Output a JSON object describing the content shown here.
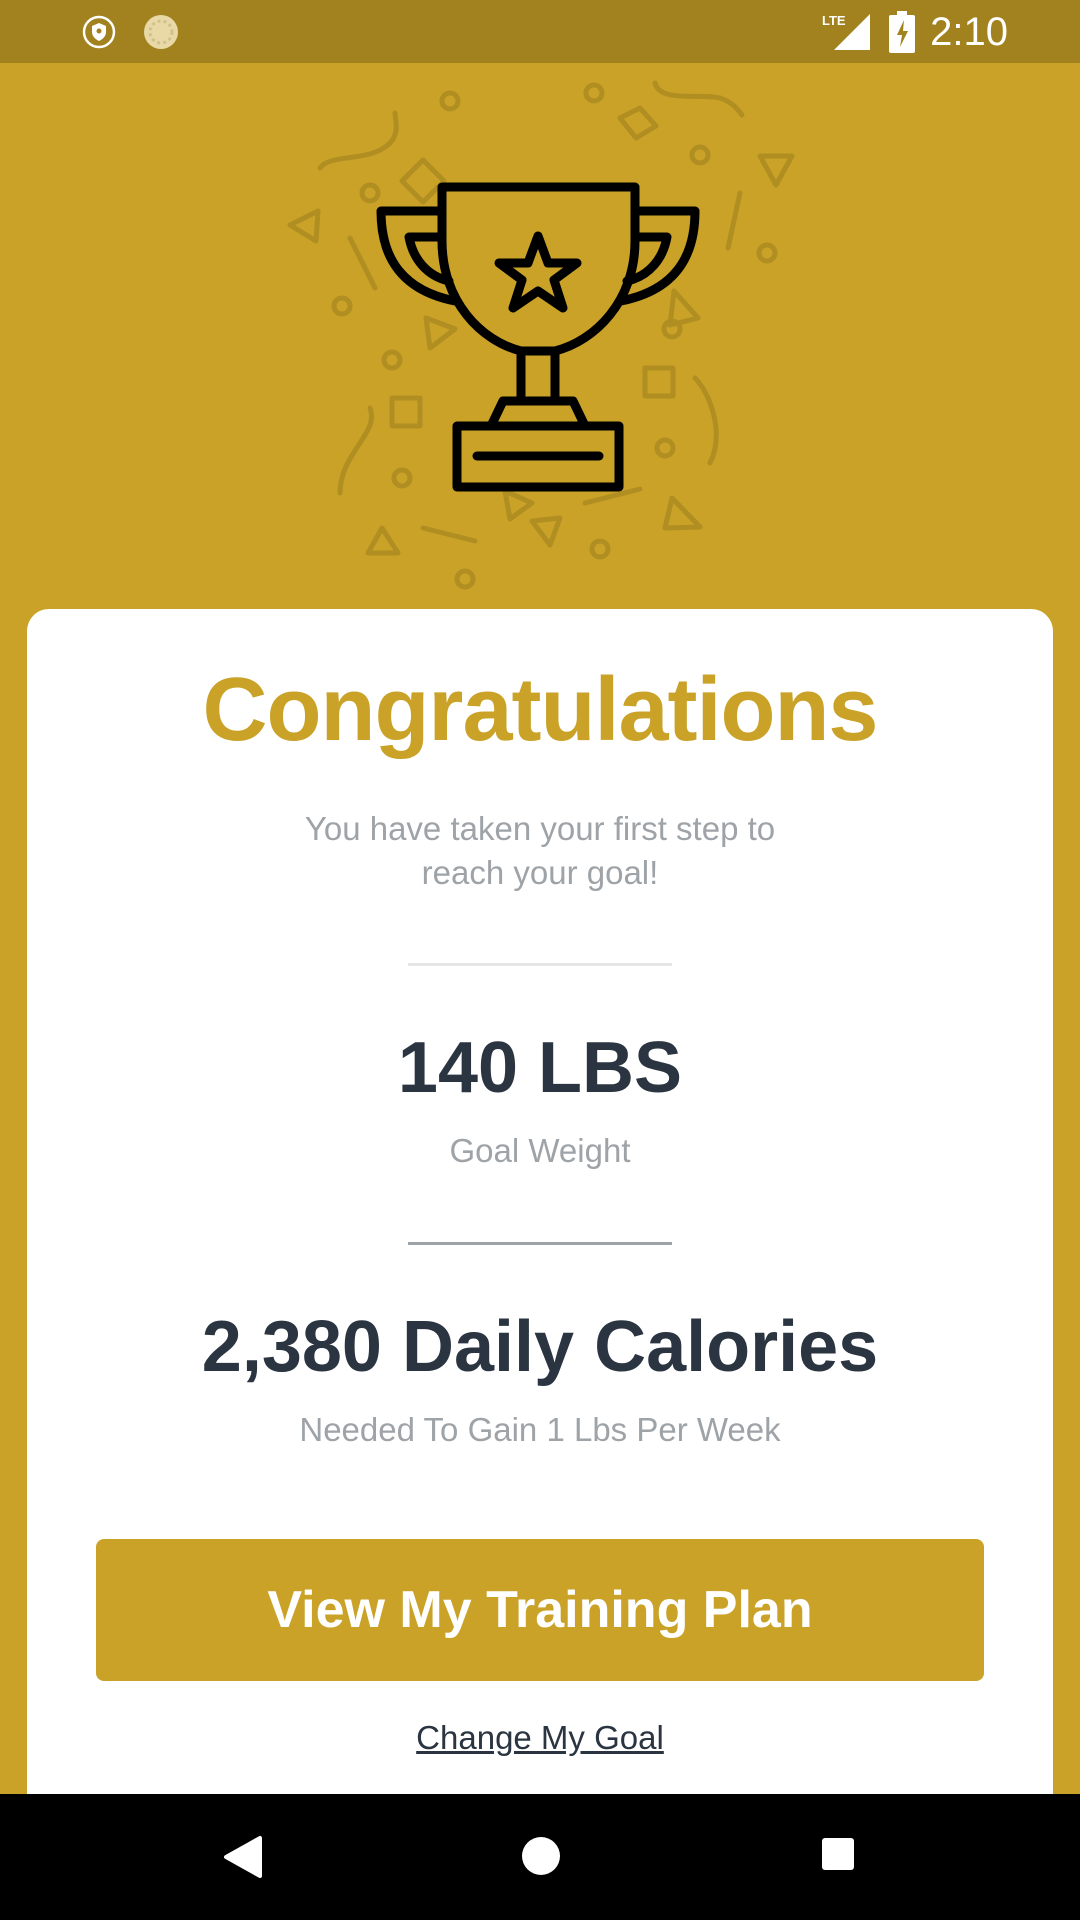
{
  "status_bar": {
    "time": "2:10",
    "network": "LTE",
    "icons": [
      "shield-notification-icon",
      "sync-notification-icon",
      "lte-signal-icon",
      "battery-charging-icon"
    ]
  },
  "hero": {
    "icon": "trophy-icon",
    "decoration": "confetti"
  },
  "card": {
    "title": "Congratulations",
    "subtitle": "You have taken your first step to reach your goal!",
    "goal": {
      "value": "140 LBS",
      "label": "Goal Weight"
    },
    "calories": {
      "value": "2,380 Daily Calories",
      "label": "Needed To Gain 1 Lbs Per Week"
    },
    "primary_button": "View My Training Plan",
    "secondary_link": "Change My Goal"
  },
  "nav_bar": {
    "buttons": [
      "back-icon",
      "home-icon",
      "recents-icon"
    ]
  },
  "colors": {
    "accent": "#C9A227",
    "status_bar": "#A2821F",
    "dark_text": "#2B3541",
    "muted_text": "#9EA3A8"
  }
}
